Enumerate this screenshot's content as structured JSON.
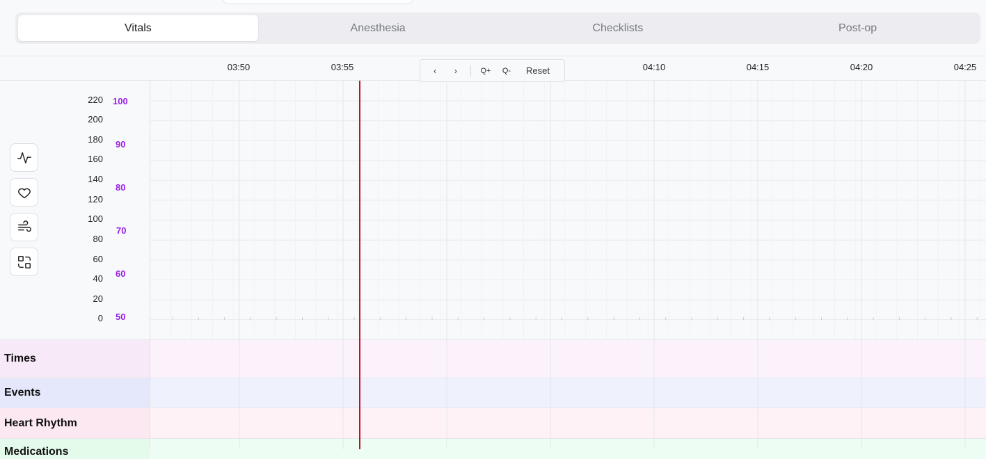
{
  "tabs": [
    {
      "label": "Vitals",
      "active": true
    },
    {
      "label": "Anesthesia",
      "active": false
    },
    {
      "label": "Checklists",
      "active": false
    },
    {
      "label": "Post-op",
      "active": false
    }
  ],
  "time_axis": {
    "labels": [
      "03:50",
      "03:55",
      "04:10",
      "04:15",
      "04:20",
      "04:25"
    ]
  },
  "controls": {
    "prev": "‹",
    "next": "›",
    "zoom_in": "Q+",
    "zoom_out": "Q-",
    "reset": "Reset"
  },
  "axis_left": [
    "220",
    "200",
    "180",
    "160",
    "140",
    "120",
    "100",
    "80",
    "60",
    "40",
    "20",
    "0"
  ],
  "axis_right": [
    "100",
    "90",
    "80",
    "70",
    "60",
    "50"
  ],
  "colors": {
    "accent_purple": "#9a1ee6",
    "now_line": "#c8101a",
    "times_row": "#f8e9f8",
    "events_row": "#e5e8fb",
    "heart_row": "#fce8f0",
    "meds_row": "#e4fbec"
  },
  "side_icons": [
    "activity-icon",
    "heart-icon",
    "wind-icon",
    "swap-icon"
  ],
  "rows": [
    {
      "label": "Times"
    },
    {
      "label": "Events"
    },
    {
      "label": "Heart Rhythm"
    },
    {
      "label": "Medications"
    }
  ]
}
